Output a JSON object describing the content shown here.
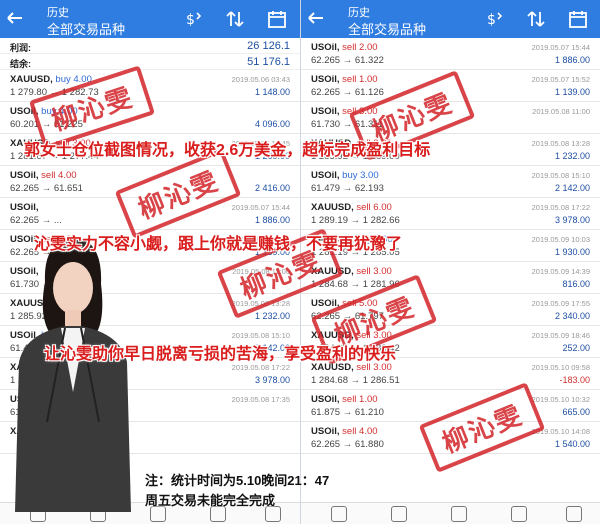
{
  "header": {
    "title_top": "历史",
    "title_main": "全部交易品种"
  },
  "summary": [
    {
      "label": "利润:",
      "value": "26 126.1"
    },
    {
      "label": "结余:",
      "value": "51 176.1"
    }
  ],
  "left_trades": [
    {
      "symbol": "XAUUSD,",
      "action": "buy 4.00",
      "side": "buy",
      "prices": "1 279.80 → 1 282.73",
      "date": "2019.05.06 03:43",
      "profit": "1 148.00",
      "neg": false
    },
    {
      "symbol": "USOil,",
      "action": "buy 4.00",
      "side": "buy",
      "prices": "60.201 → 61.225",
      "date": "",
      "profit": "4 096.00",
      "neg": false
    },
    {
      "symbol": "XAUUSD,",
      "action": "sell 3.00",
      "side": "sell",
      "prices": "1 281.67 → 1 277.44",
      "date": "2019.05.06 15:45",
      "profit": "1 269.00",
      "neg": false
    },
    {
      "symbol": "USOil,",
      "action": "sell 4.00",
      "side": "sell",
      "prices": "62.265 → 61.651",
      "date": "",
      "profit": "2 416.00",
      "neg": false
    },
    {
      "symbol": "USOil,",
      "action": "",
      "side": "sell",
      "prices": "62.265 → ...",
      "date": "2019.05.07 15:44",
      "profit": "1 886.00",
      "neg": false
    },
    {
      "symbol": "USOil,",
      "action": "sell 1.00",
      "side": "sell",
      "prices": "62.265 → ...",
      "date": "2019.05.07 15:52",
      "profit": "1 139.00",
      "neg": false
    },
    {
      "symbol": "USOil,",
      "action": "",
      "side": "sell",
      "prices": "61.730 → ...",
      "date": "2019.05.08 11:00",
      "profit": "",
      "neg": false
    },
    {
      "symbol": "XAUUSD,",
      "action": "sell 3.00",
      "side": "sell",
      "prices": "1 285.92 → 1 289.00",
      "date": "2019.05.08 13:28",
      "profit": "1 232.00",
      "neg": false
    },
    {
      "symbol": "USOil,",
      "action": "buy 3.00",
      "side": "buy",
      "prices": "61.479 → 62.193",
      "date": "2019.05.08 15:10",
      "profit": "2 142.00",
      "neg": false
    },
    {
      "symbol": "XAUUSD,",
      "action": "sell 6.00",
      "side": "sell",
      "prices": "1 289.19 → 1 282.66",
      "date": "2019.05.08 17:22",
      "profit": "3 978.00",
      "neg": false
    },
    {
      "symbol": "USOil,",
      "action": "buy 5.00",
      "side": "buy",
      "prices": "61.000 → ...",
      "date": "2019.05.08 17:35",
      "profit": "",
      "neg": false
    },
    {
      "symbol": "XAUUSD,",
      "action": "",
      "side": "sell",
      "prices": "",
      "date": "",
      "profit": "",
      "neg": false
    }
  ],
  "right_trades": [
    {
      "symbol": "USOil,",
      "action": "sell 2.00",
      "side": "sell",
      "prices": "62.265 → 61.322",
      "date": "2019.05.07 15:44",
      "profit": "1 886.00",
      "neg": false
    },
    {
      "symbol": "USOil,",
      "action": "sell 1.00",
      "side": "sell",
      "prices": "62.265 → 61.126",
      "date": "2019.05.07 15:52",
      "profit": "1 139.00",
      "neg": false
    },
    {
      "symbol": "USOil,",
      "action": "sell 3.00",
      "side": "sell",
      "prices": "61.730 → 61.311",
      "date": "2019.05.08 11:00",
      "profit": "",
      "neg": false
    },
    {
      "symbol": "XAUUSD,",
      "action": "sell 3.00",
      "side": "sell",
      "prices": "1 285.92 → 1 289.00",
      "date": "2019.05.08 13:28",
      "profit": "1 232.00",
      "neg": false
    },
    {
      "symbol": "USOil,",
      "action": "buy 3.00",
      "side": "buy",
      "prices": "61.479 → 62.193",
      "date": "2019.05.08 15:10",
      "profit": "2 142.00",
      "neg": false
    },
    {
      "symbol": "XAUUSD,",
      "action": "sell 6.00",
      "side": "sell",
      "prices": "1 289.19 → 1 282.66",
      "date": "2019.05.08 17:22",
      "profit": "3 978.00",
      "neg": false
    },
    {
      "symbol": "XAUUSD,",
      "action": "buy 5.00",
      "side": "buy",
      "prices": "1 281.19 → 1 285.05",
      "date": "2019.05.09 10:03",
      "profit": "1 930.00",
      "neg": false
    },
    {
      "symbol": "XAUUSD,",
      "action": "sell 3.00",
      "side": "sell",
      "prices": "1 284.68 → 1 281.96",
      "date": "2019.05.09 14:39",
      "profit": "816.00",
      "neg": false
    },
    {
      "symbol": "USOil,",
      "action": "sell 5.00",
      "side": "sell",
      "prices": "62.265 → 61.797",
      "date": "2019.05.09 17:55",
      "profit": "2 340.00",
      "neg": false
    },
    {
      "symbol": "XAUUSD,",
      "action": "sell 3.00",
      "side": "sell",
      "prices": "1 284.68 → 1 283.42",
      "date": "2019.05.09 18:46",
      "profit": "252.00",
      "neg": false
    },
    {
      "symbol": "XAUUSD,",
      "action": "sell 3.00",
      "side": "sell",
      "prices": "1 284.68 → 1 286.51",
      "date": "2019.05.10 09:58",
      "profit": "-183.00",
      "neg": true
    },
    {
      "symbol": "USOil,",
      "action": "sell 1.00",
      "side": "sell",
      "prices": "61.875 → 61.210",
      "date": "2019.05.10 10:32",
      "profit": "665.00",
      "neg": false
    },
    {
      "symbol": "USOil,",
      "action": "sell 4.00",
      "side": "sell",
      "prices": "62.265 → 61.880",
      "date": "2019.05.10 14:08",
      "profit": "1 540.00",
      "neg": false
    }
  ],
  "overlay": {
    "line1": "郭女士仓位截图情况，收获2.6万美金，超标完成盈利目标",
    "line2": "沁雯实力不容小觑，跟上你就是赚钱，不要再犹豫了",
    "line3": "让沁雯助你早日脱离亏损的苦海，享受盈利的快乐",
    "note1": "注：统计时间为5.10晚间21：47",
    "note2": "周五交易未能完全完成"
  },
  "stamp_text": "柳沁雯",
  "colors": {
    "header": "#2f7de1",
    "buy": "#2f6bd8",
    "sell": "#d32f2f",
    "stamp": "#d3242a",
    "overlay": "#d91c1c"
  }
}
